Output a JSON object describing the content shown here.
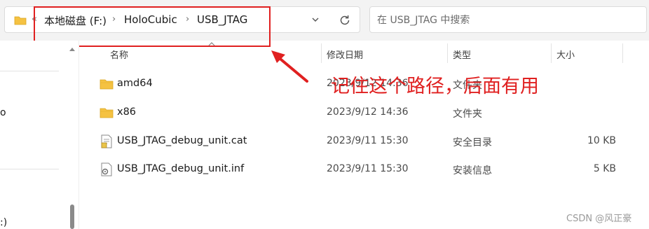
{
  "address_bar": {
    "breadcrumbs": [
      "本地磁盘 (F:)",
      "HoloCubic",
      "USB_JTAG"
    ],
    "overflow_chevron": "«",
    "separator": "›"
  },
  "search": {
    "placeholder": "在 USB_JTAG 中搜索"
  },
  "nav_pane": {
    "partial_items": [
      "o",
      ":)"
    ]
  },
  "columns": {
    "name": "名称",
    "modified": "修改日期",
    "type": "类型",
    "size": "大小"
  },
  "files": [
    {
      "name": "amd64",
      "modified": "2023/9/12 14:36",
      "type": "文件夹",
      "size": "",
      "icon": "folder-icon"
    },
    {
      "name": "x86",
      "modified": "2023/9/12 14:36",
      "type": "文件夹",
      "size": "",
      "icon": "folder-icon"
    },
    {
      "name": "USB_JTAG_debug_unit.cat",
      "modified": "2023/9/11 15:30",
      "type": "安全目录",
      "size": "10 KB",
      "icon": "security-catalog-icon"
    },
    {
      "name": "USB_JTAG_debug_unit.inf",
      "modified": "2023/9/11 15:30",
      "type": "安装信息",
      "size": "5 KB",
      "icon": "setup-info-icon"
    }
  ],
  "annotation": {
    "text": "记住这个路径，后面有用",
    "color": "#e02020"
  },
  "watermark": "CSDN @风正豪",
  "colors": {
    "accent_red": "#e02020",
    "folder_yellow": "#f5c242",
    "toolbar_bg": "#f3f3f3"
  }
}
